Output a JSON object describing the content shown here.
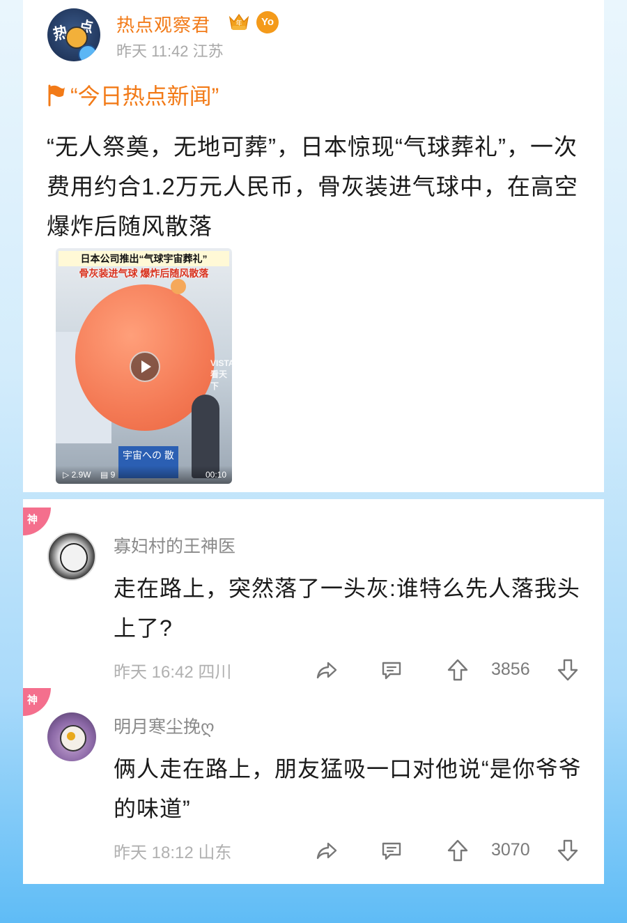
{
  "post": {
    "author": "热点观察君",
    "time": "昨天 11:42",
    "location": "江苏",
    "badge_yo": "Yo",
    "crown_badge_icon": "crown-badge-icon",
    "topic": "“今日热点新闻”",
    "text": "“无人祭奠，无地可葬”，日本惊现“气球葬礼”，一次费用约合1.2万元人民币，骨灰装进气球中，在高空爆炸后随风散落",
    "video": {
      "banner_line1": "日本公司推出“气球宇宙葬礼”",
      "banner_line2": "骨灰装进气球 爆炸后随风散落",
      "watermark": "VISTA 看天下",
      "sign_text": "宇宙への 散",
      "views": "2.9W",
      "danmaku_count": "9",
      "duration": "00:10"
    }
  },
  "comments": [
    {
      "tag": "神",
      "name": "寡妇村的王神医",
      "text": "走在路上，突然落了一头灰:谁特么先人落我头上了?",
      "time": "昨天 16:42",
      "location": "四川",
      "likes": "3856"
    },
    {
      "tag": "神",
      "name": "明月寒尘挽ღ",
      "text": "俩人走在路上，朋友猛吸一口对他说“是你爷爷的味道”",
      "time": "昨天 18:12",
      "location": "山东",
      "likes": "3070"
    }
  ],
  "colors": {
    "accent_orange": "#f27a17",
    "god_tag_pink": "#f46f8d",
    "muted_gray": "#a8a8a8"
  }
}
